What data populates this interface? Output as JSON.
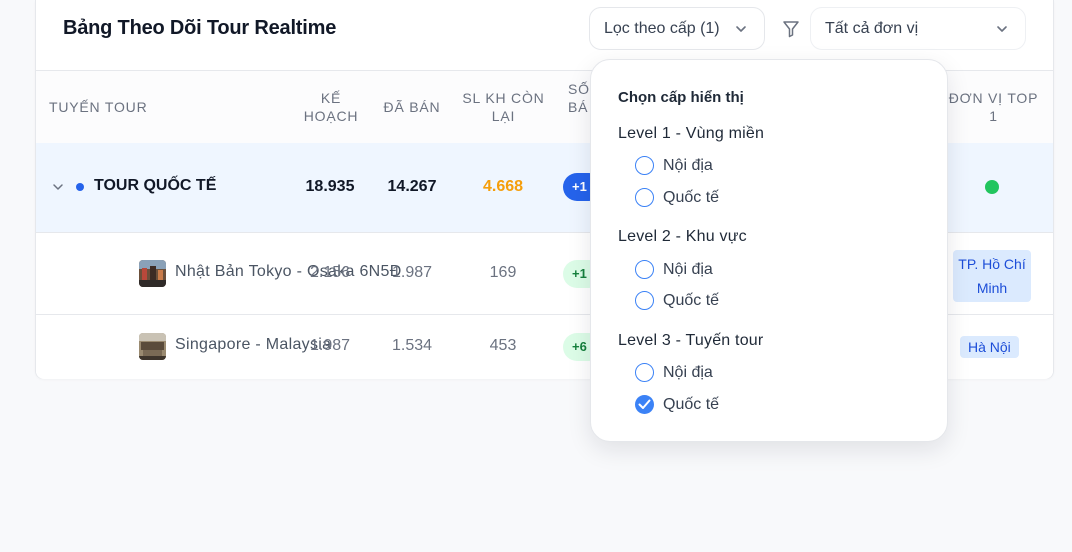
{
  "header": {
    "title": "Bảng Theo Dõi Tour Realtime",
    "level_filter_label": "Lọc theo cấp (1)",
    "unit_select_value": "Tất cả đơn vị"
  },
  "table": {
    "columns": {
      "tour": "TUYẾN TOUR",
      "plan_line1": "KẾ",
      "plan_line2": "HOẠCH",
      "sold": "ĐÃ BÁN",
      "remaining_line1": "SL KH CÒN",
      "remaining_line2": "LẠI",
      "partial_line1": "SỐ",
      "partial_line2": "BÁ",
      "top_unit_line1": "ĐƠN VỊ TOP",
      "top_unit_line2": "1"
    },
    "group_row": {
      "name": "TOUR QUỐC TẾ",
      "plan": "18.935",
      "sold": "14.267",
      "remaining": "4.668",
      "badge": "+1",
      "status_color": "#22c55e"
    },
    "rows": [
      {
        "name": "Nhật Bản Tokyo - Osaka 6N5Đ",
        "plan": "2.156",
        "sold": "1.987",
        "remaining": "169",
        "badge": "+1",
        "top_unit_line1": "TP. Hồ Chí",
        "top_unit_line2": "Minh"
      },
      {
        "name": "Singapore - Malaysia",
        "plan": "1.987",
        "sold": "1.534",
        "remaining": "453",
        "badge": "+6",
        "top_unit": "Hà Nội"
      }
    ]
  },
  "popup": {
    "title": "Chọn cấp hiển thị",
    "groups": [
      {
        "label": "Level 1 - Vùng miền",
        "options": [
          {
            "label": "Nội địa",
            "checked": false
          },
          {
            "label": "Quốc tế",
            "checked": false
          }
        ]
      },
      {
        "label": "Level 2 - Khu vực",
        "options": [
          {
            "label": "Nội địa",
            "checked": false
          },
          {
            "label": "Quốc tế",
            "checked": false
          }
        ]
      },
      {
        "label": "Level 3 - Tuyến tour",
        "options": [
          {
            "label": "Nội địa",
            "checked": false
          },
          {
            "label": "Quốc tế",
            "checked": true
          }
        ]
      }
    ]
  },
  "colors": {
    "accent": "#3b82f6",
    "remaining_highlight": "#f59e0b",
    "group_row_bg": "#eff6ff",
    "tag_bg": "#dbeafe"
  }
}
